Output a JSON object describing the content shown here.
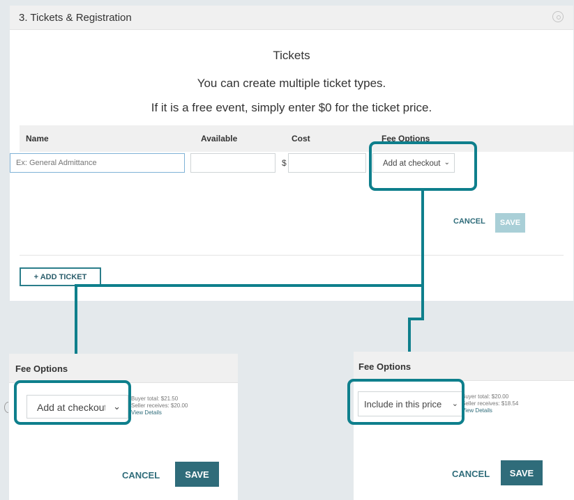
{
  "section": {
    "title": "3. Tickets & Registration"
  },
  "tickets": {
    "heading": "Tickets",
    "line1": "You can create multiple ticket types.",
    "line2": "If it is a free event, simply enter $0 for the ticket price."
  },
  "table": {
    "headers": [
      "Name",
      "Available",
      "Cost",
      "Fee Options"
    ],
    "name_placeholder": "Ex: General Admittance",
    "currency": "$",
    "fee_option_selected": "Add at checkout",
    "cancel_label": "CANCEL",
    "save_label": "SAVE"
  },
  "add_ticket_label": "+ ADD TICKET",
  "panel_left": {
    "title": "Fee Options",
    "selected": "Add at checkout",
    "buyer_total": "Buyer total: $21.50",
    "seller_receives": "Seller receives: $20.00",
    "view_details": "View Details",
    "cancel_label": "CANCEL",
    "save_label": "SAVE"
  },
  "panel_right": {
    "title": "Fee Options",
    "selected": "Include in this price",
    "buyer_total": "Buyer total: $20.00",
    "seller_receives": "Seller receives: $18.54",
    "view_details": "View Details",
    "cancel_label": "CANCEL",
    "save_label": "SAVE"
  },
  "colors": {
    "accent": "#0e7f8c",
    "button": "#2f6c7a",
    "save_disabled": "#a9cfd7"
  }
}
